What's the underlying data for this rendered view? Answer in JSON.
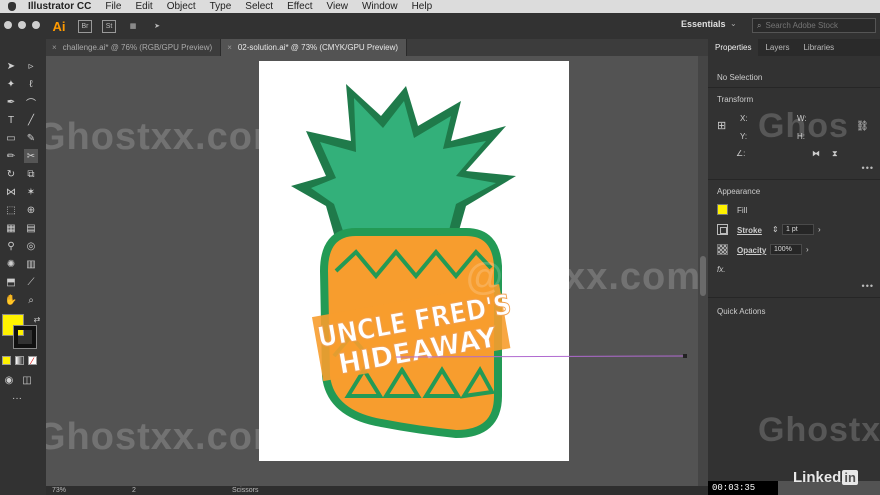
{
  "menubar": {
    "app": "Illustrator CC",
    "items": [
      "File",
      "Edit",
      "Object",
      "Type",
      "Select",
      "Effect",
      "View",
      "Window",
      "Help"
    ]
  },
  "appbar": {
    "logo": "Ai",
    "bridge": "Br",
    "stock": "St",
    "workspace": "Essentials",
    "search_placeholder": "Search Adobe Stock"
  },
  "tabs": [
    {
      "label": "challenge.ai* @ 76% (RGB/GPU Preview)",
      "active": false
    },
    {
      "label": "02-solution.ai* @ 73% (CMYK/GPU Preview)",
      "active": true
    }
  ],
  "artwork": {
    "line1": "UNCLE FRED'S",
    "line2": "HIDEAWAY",
    "colors": {
      "leaves_dark": "#1f7a4a",
      "leaves_light": "#33b07a",
      "body_outline": "#239a55",
      "body_fill": "#f79d2e",
      "text": "#ffffff",
      "path_line": "#b06ad0"
    }
  },
  "watermark": {
    "text": "Ghostxx.com",
    "short": "@ostxx.com",
    "mid": "Ghos",
    "small": "Ghostxx"
  },
  "panel": {
    "tabs": [
      "Properties",
      "Layers",
      "Libraries"
    ],
    "selection": "No Selection",
    "transform_title": "Transform",
    "x_label": "X:",
    "y_label": "Y:",
    "w_label": "W:",
    "h_label": "H:",
    "angle_label": "∠:",
    "appearance_title": "Appearance",
    "fill_label": "Fill",
    "stroke_label": "Stroke",
    "stroke_value": "1 pt",
    "opacity_label": "Opacity",
    "opacity_value": "100%",
    "fx_label": "fx.",
    "quick_actions_title": "Quick Actions"
  },
  "status": {
    "zoom": "73%",
    "page": "2",
    "tool": "Scissors"
  },
  "video": {
    "timecode": "00:03:35",
    "brand": "Linked",
    "brand_in": "in"
  }
}
